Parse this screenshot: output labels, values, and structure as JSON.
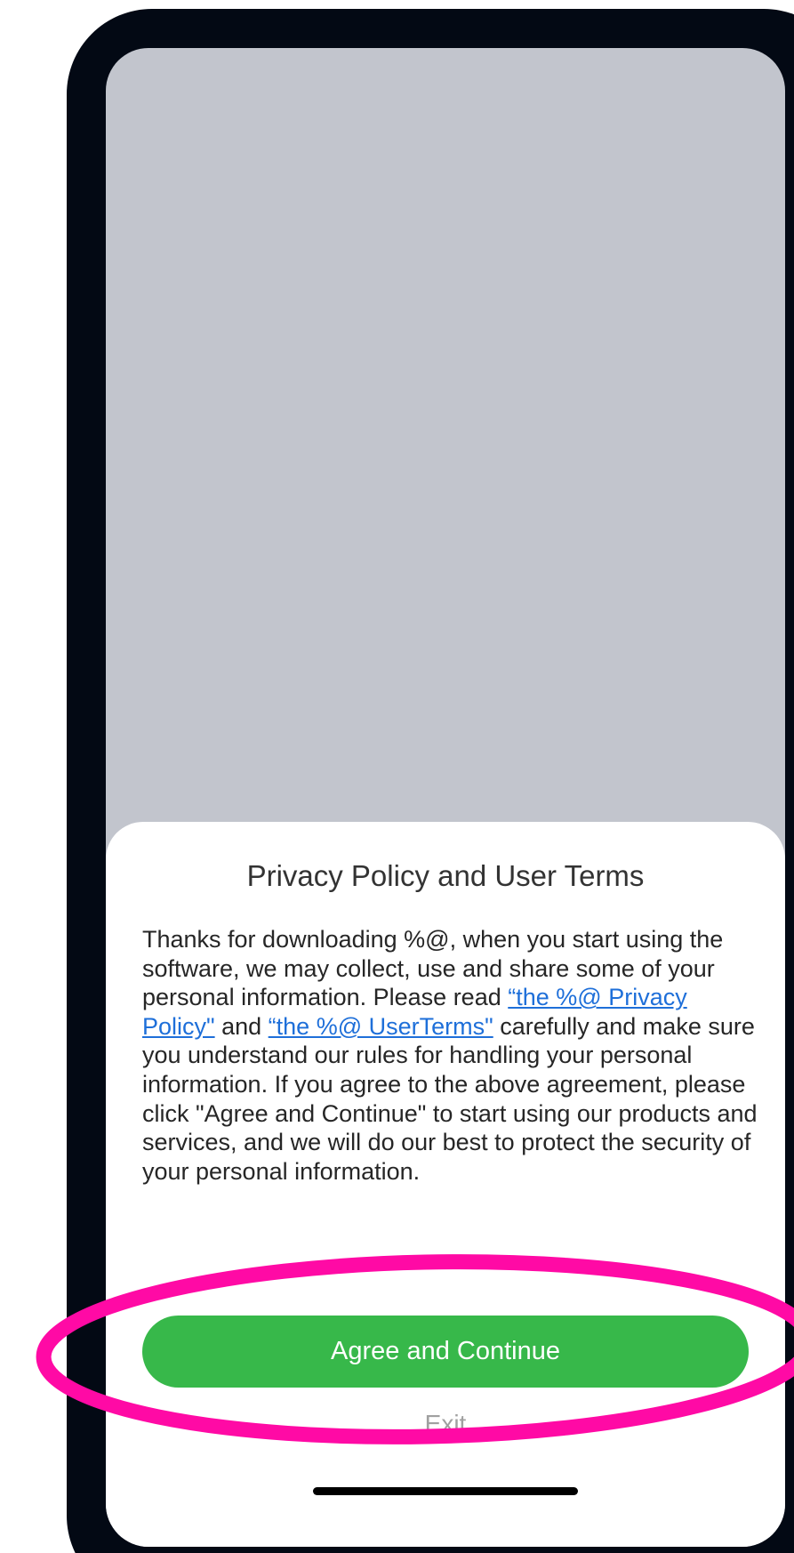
{
  "dialog": {
    "title": "Privacy Policy and User Terms",
    "body_part1": "Thanks for downloading %@, when you start using the software, we may collect, use and share some of your personal information. Please read ",
    "privacy_link": "“the %@ Privacy Policy\"",
    "body_and": " and ",
    "terms_link": "“the %@ UserTerms\"",
    "body_part2": " carefully and make sure you understand our rules for handling your personal information. If you agree to the above agreement, please click \"Agree and Continue\" to start using our products and services, and we will do our best to protect the security of your personal information.",
    "agree_label": "Agree and Continue",
    "exit_label": "Exit"
  },
  "colors": {
    "phone_frame": "#030914",
    "screen_background": "#c2c5cd",
    "sheet_background": "#ffffff",
    "agree_button": "#37b84a",
    "link": "#1e6fd9",
    "highlight_ellipse": "#ff0aa5"
  }
}
